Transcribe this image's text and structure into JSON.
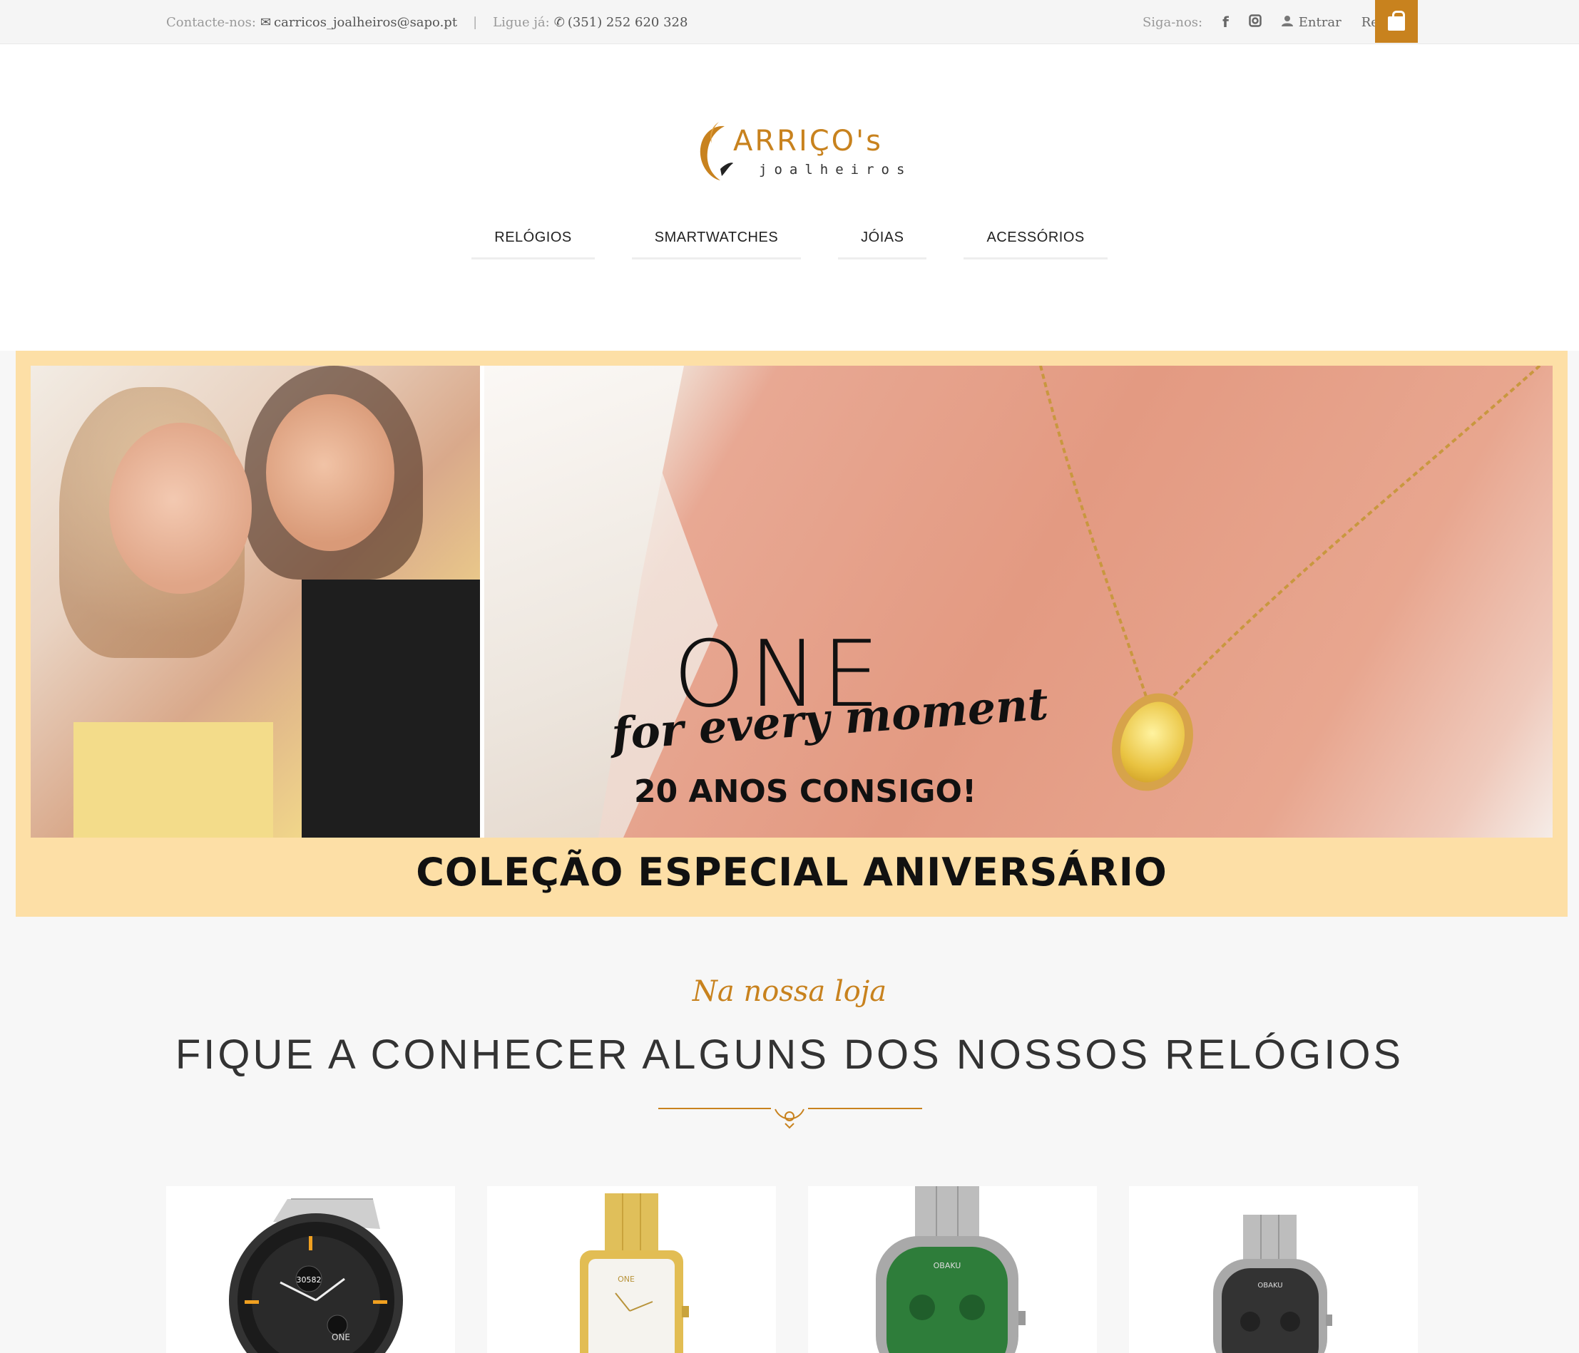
{
  "topbar": {
    "contact_label": "Contacte-nos:",
    "email": "carricos_joalheiros@sapo.pt",
    "phone_label": "Ligue já:",
    "phone": "(351) 252 620 328",
    "follow_label": "Siga-nos:",
    "facebook_icon": "f",
    "login": "Entrar",
    "register": "Registar"
  },
  "logo": {
    "brand": "ARRIÇO's",
    "sub": "joalheiros"
  },
  "nav": {
    "items": [
      "RELÓGIOS",
      "SMARTWATCHES",
      "JÓIAS",
      "ACESSÓRIOS"
    ]
  },
  "banner": {
    "brand": "ONE",
    "tagline": "for every moment",
    "anos": "20 ANOS CONSIGO!",
    "collection": "COLEÇÃO ESPECIAL ANIVERSÁRIO"
  },
  "section": {
    "script": "Na nossa loja",
    "heading": "FIQUE A CONHECER ALGUNS DOS NOSSOS RELÓGIOS"
  },
  "products": [
    {
      "dial_text": "30582",
      "brand": "ONE"
    },
    {
      "brand": "ONE"
    },
    {
      "brand": "OBAKU"
    },
    {
      "brand": "OBAKU"
    }
  ],
  "colors": {
    "accent": "#c8821e",
    "banner_bg": "#fddfa6",
    "page_bg": "#f7f7f7"
  }
}
